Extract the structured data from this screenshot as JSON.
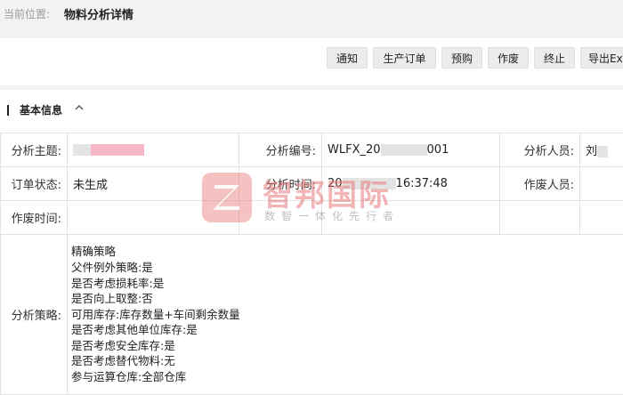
{
  "breadcrumb": {
    "label": "当前位置:",
    "page": "物料分析详情"
  },
  "toolbar": {
    "buttons": [
      {
        "label": "通知"
      },
      {
        "label": "生产订单"
      },
      {
        "label": "预购"
      },
      {
        "label": "作废"
      },
      {
        "label": "终止"
      },
      {
        "label": "导出Ex"
      }
    ]
  },
  "section": {
    "title": "基本信息",
    "icon": "chevron-up-icon"
  },
  "fields": {
    "subject_label": "分析主题:",
    "number_label": "分析编号:",
    "number_prefix": "WLFX_20",
    "number_suffix": "001",
    "analyst_label": "分析人员:",
    "analyst_value": "刘",
    "order_status_label": "订单状态:",
    "order_status_value": "未生成",
    "time_label": "分析时间:",
    "time_prefix": "20",
    "time_suffix": "16:37:48",
    "voider_label": "作废人员:",
    "void_time_label": "作废时间:",
    "strategy_label": "分析策略:",
    "strategy_lines": [
      "精确策略",
      "父件例外策略:是",
      "是否考虑损耗率:是",
      "是否向上取整:否",
      "可用库存:库存数量+车间剩余数量",
      "是否考虑其他单位库存:是",
      "是否考虑安全库存:是",
      "是否考虑替代物料:无",
      "参与运算仓库:全部仓库"
    ]
  },
  "watermark": {
    "name": "智邦国际",
    "tagline": "数智一体化先行者"
  },
  "colors": {
    "mask_pink": "#f6b8c8",
    "mask_gray": "#e4e4e4",
    "watermark": "#e87878"
  }
}
